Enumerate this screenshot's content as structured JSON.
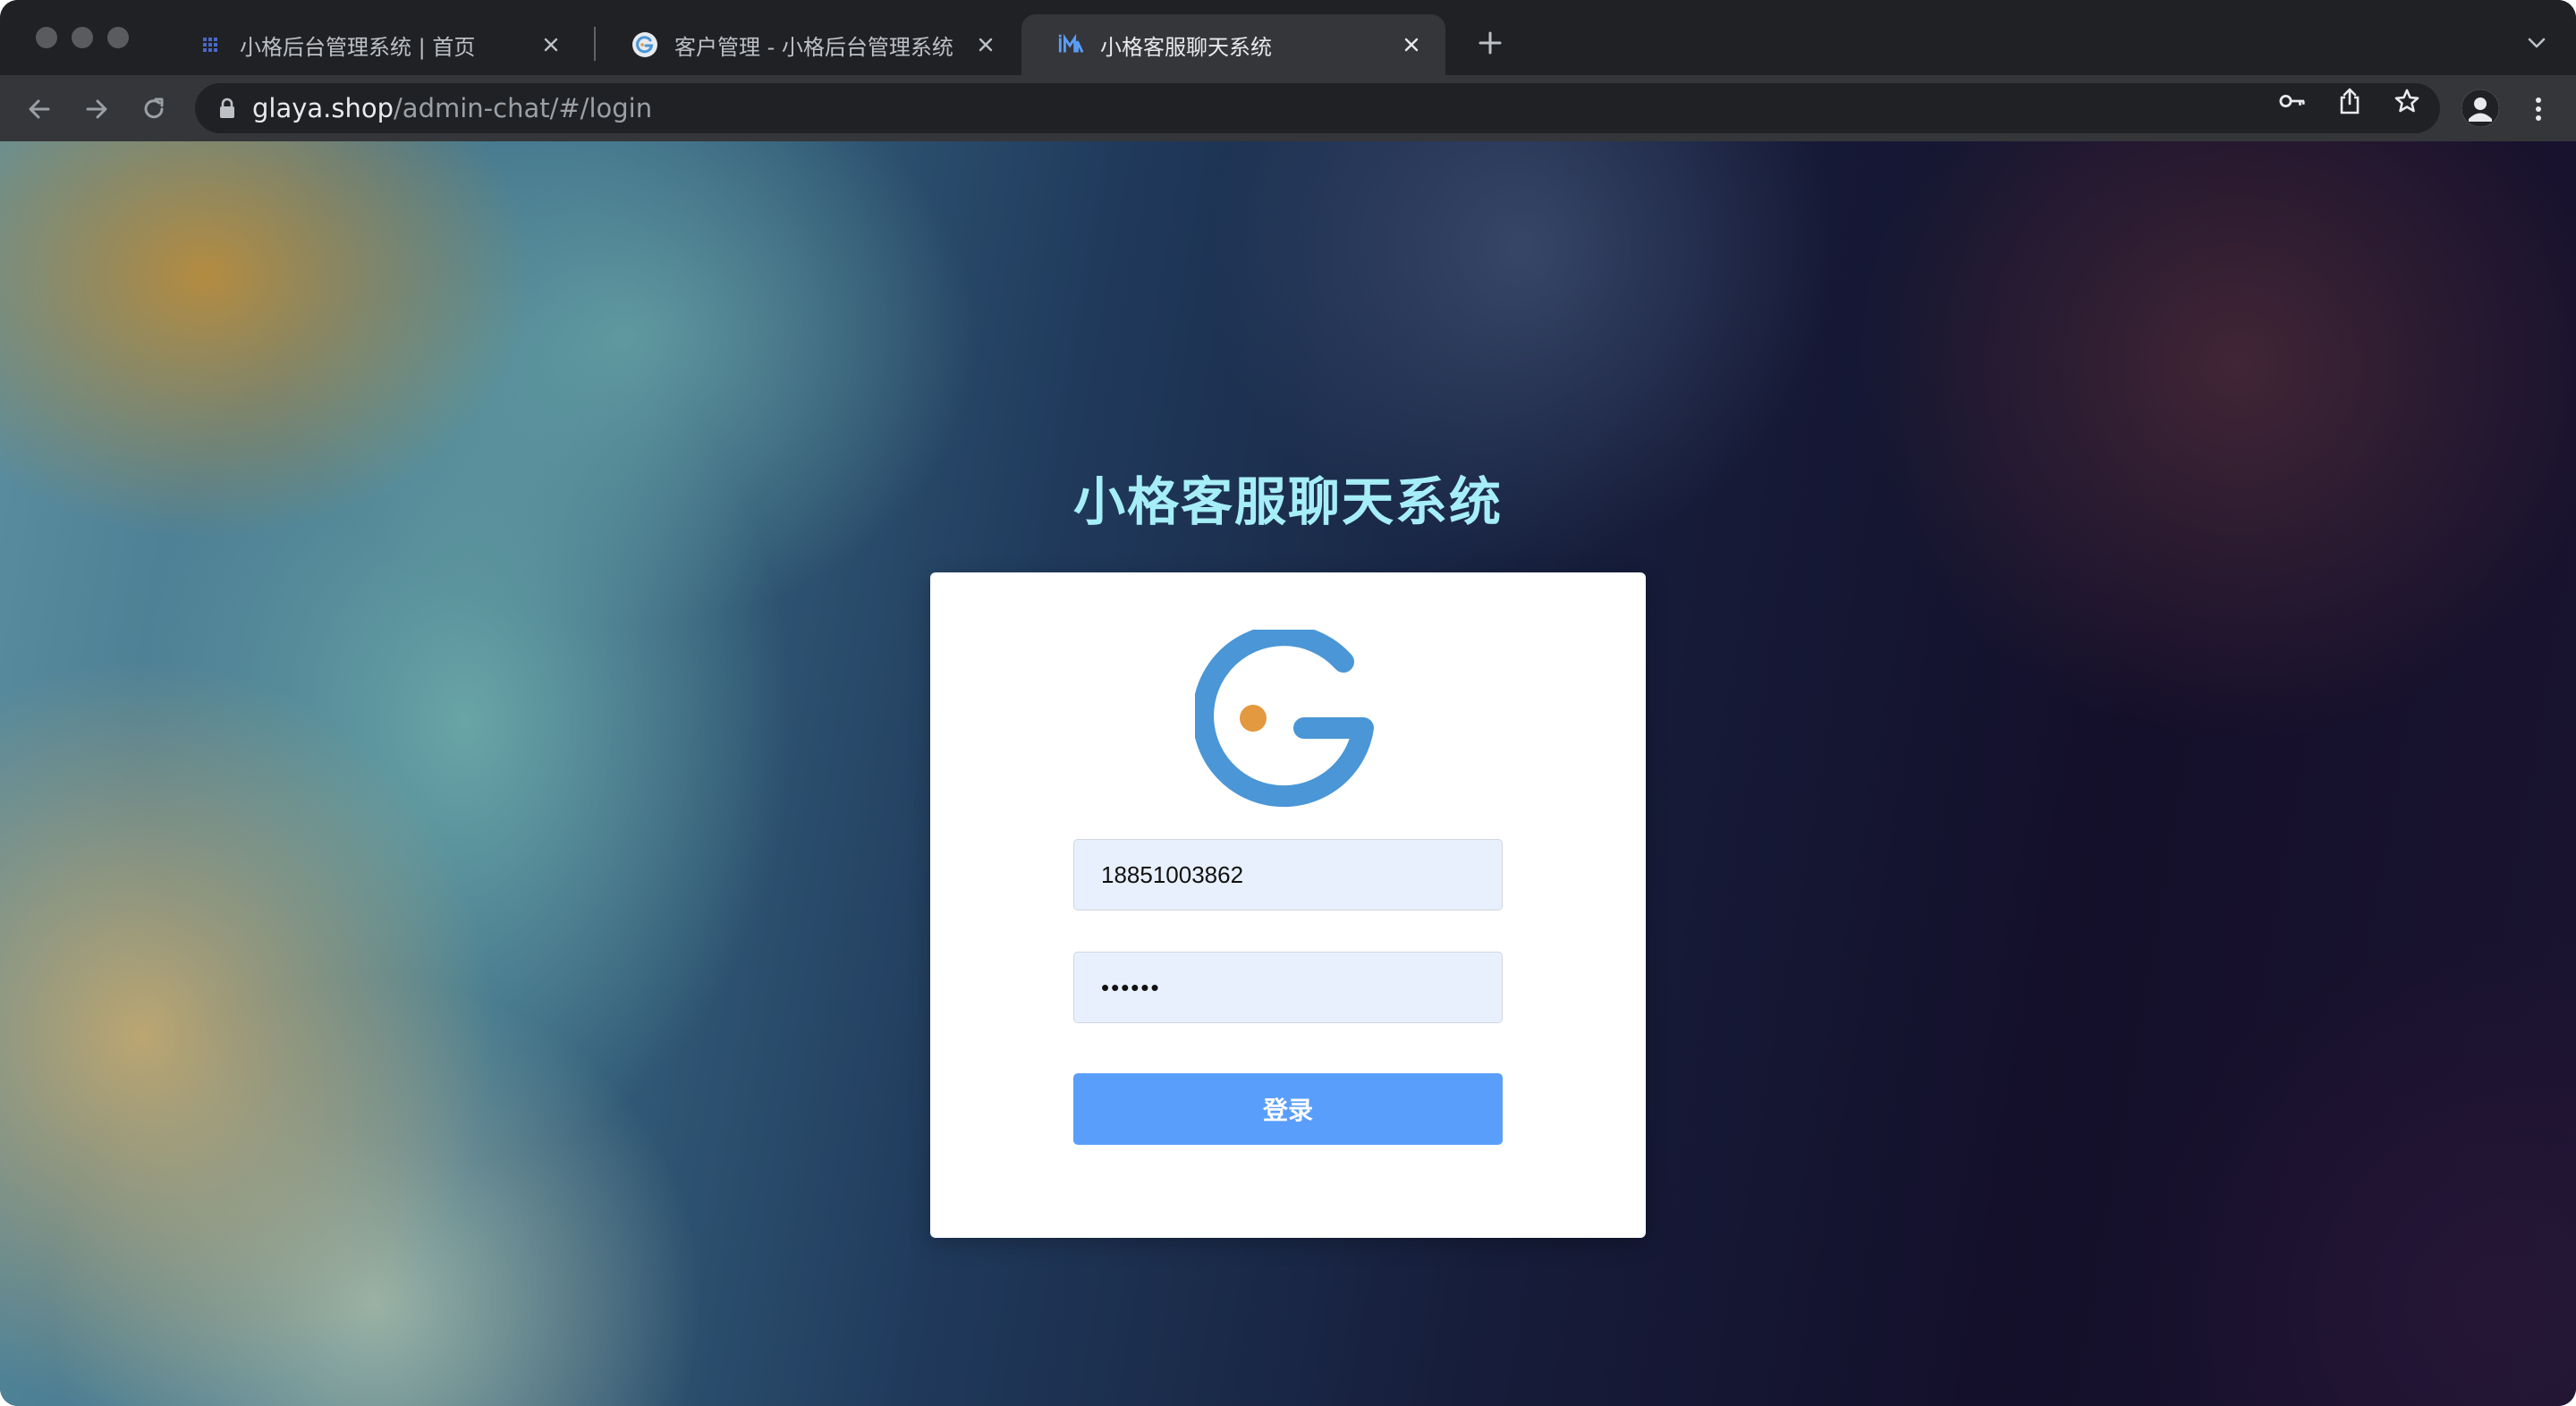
{
  "browser": {
    "tabs": [
      {
        "title": "小格后台管理系统 | 首页",
        "favicon": "grid-favicon-icon",
        "active": false
      },
      {
        "title": "客户管理 - 小格后台管理系统",
        "favicon": "g-logo-favicon-icon",
        "active": false
      },
      {
        "title": "小格客服聊天系统",
        "favicon": "im-favicon-icon",
        "active": true
      }
    ],
    "url": {
      "host": "glaya.shop",
      "path": "/admin-chat/#/login"
    },
    "icons": [
      "back-icon",
      "forward-icon",
      "reload-icon",
      "lock-icon",
      "key-icon",
      "share-icon",
      "star-icon",
      "profile-icon",
      "menu-icon",
      "new-tab-icon",
      "tab-search-icon"
    ]
  },
  "login": {
    "title": "小格客服聊天系统",
    "username_value": "18851003862",
    "password_value": "••••••",
    "submit_label": "登录",
    "logo": "g-logo-icon"
  },
  "colors": {
    "title": "#a6eef7",
    "button": "#5a9efb",
    "input_bg": "#e8f0fe",
    "logo_blue": "#4a96d6",
    "logo_dot": "#e3993f"
  }
}
